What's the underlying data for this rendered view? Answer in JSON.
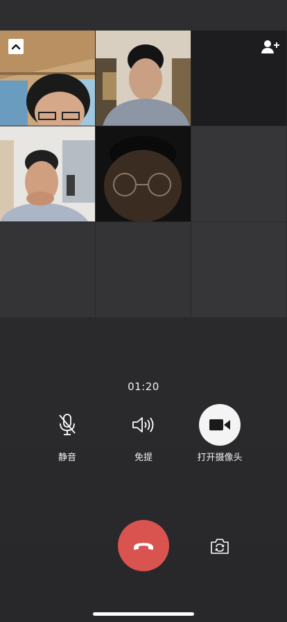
{
  "call": {
    "timer": "01:20"
  },
  "controls": {
    "mute_label": "静音",
    "speaker_label": "免提",
    "camera_label": "打开摄像头"
  },
  "icons": {
    "collapse": "chevron-up-icon",
    "add_member": "add-person-icon",
    "mute": "microphone-off-icon",
    "speaker": "speaker-icon",
    "camera": "video-camera-icon",
    "hangup": "phone-hangup-icon",
    "switch_camera": "camera-switch-icon"
  },
  "colors": {
    "hangup": "#d9534f",
    "camera_button_bg": "#f4f4f4",
    "background": "#2a2a2c"
  }
}
